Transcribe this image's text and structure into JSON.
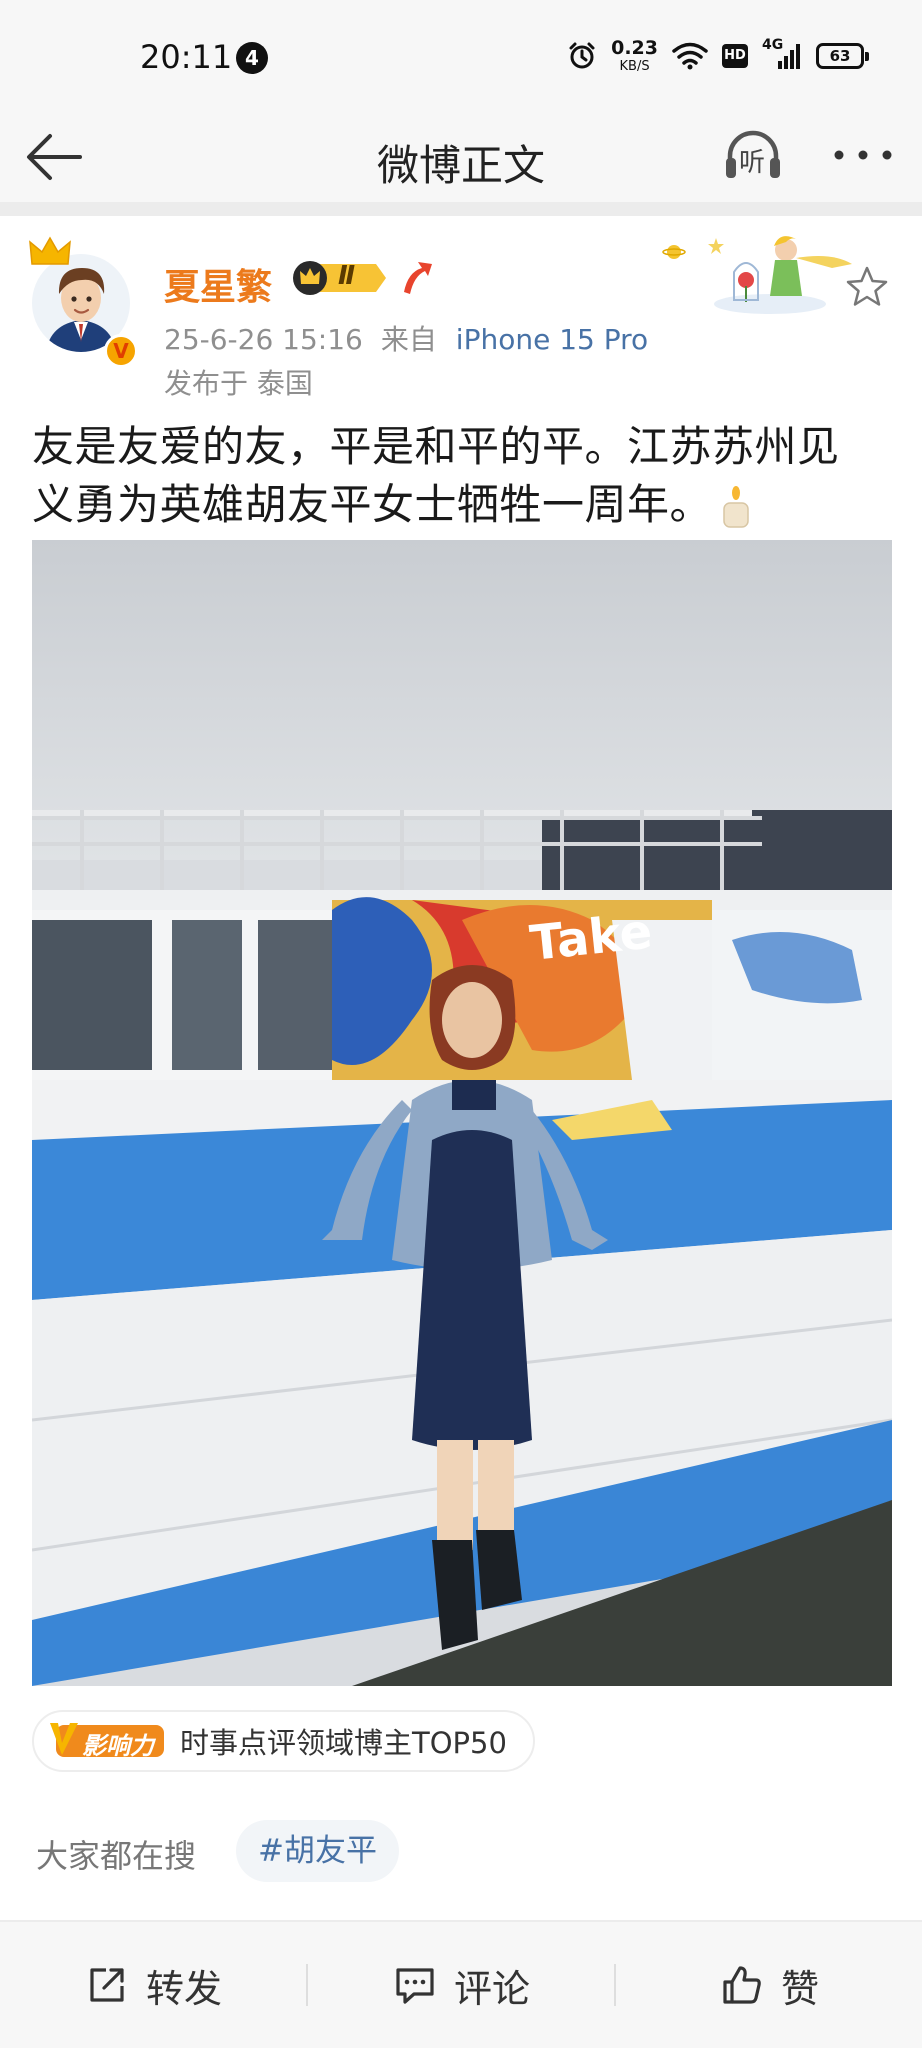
{
  "status_bar": {
    "time": "20:11",
    "notification_count": "4",
    "net_speed": "0.23",
    "net_unit": "KB/S",
    "hd": "HD",
    "network": "4G",
    "battery": "63"
  },
  "nav": {
    "title": "微博正文",
    "listen_label": "听"
  },
  "author": {
    "name": "夏星繁",
    "level": "Ⅱ",
    "verified_mark": "V"
  },
  "post": {
    "date": "25-6-26 15:16",
    "from_label": "来自",
    "device": "iPhone 15 Pro",
    "location": "发布于 泰国",
    "text_line1": "友是友爱的友，平是和平的平。江苏苏州见",
    "text_line2": "义勇为英雄胡友平女士牺牲一周年。"
  },
  "influence": {
    "badge_text": "影响力",
    "text": "时事点评领域博主TOP50"
  },
  "search": {
    "label": "大家都在搜",
    "tag": "#胡友平"
  },
  "actions": {
    "repost": "转发",
    "comment": "评论",
    "like": "赞"
  },
  "colors": {
    "author_name": "#ec7a1c",
    "link_blue": "#4872a6",
    "meta_gray": "#8f8f8f"
  }
}
